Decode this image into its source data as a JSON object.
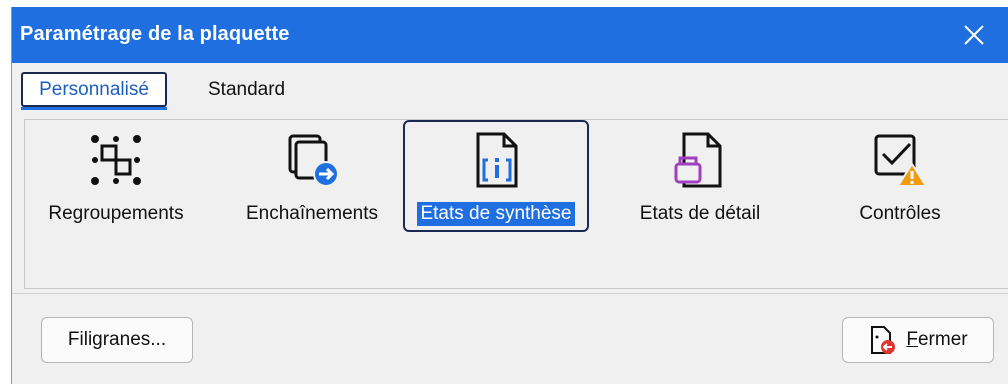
{
  "window": {
    "title": "Paramétrage de la plaquette",
    "close_icon": "close-icon"
  },
  "tabs": [
    {
      "label": "Personnalisé",
      "active": true
    },
    {
      "label": "Standard",
      "active": false
    }
  ],
  "toolbar": {
    "items": [
      {
        "label": "Regroupements",
        "icon": "grouping-icon",
        "selected": false
      },
      {
        "label": "Enchaînements",
        "icon": "chaining-icon",
        "selected": false
      },
      {
        "label": "Etats de synthèse",
        "icon": "summary-report-icon",
        "selected": true
      },
      {
        "label": "Etats de détail",
        "icon": "detail-report-icon",
        "selected": false
      },
      {
        "label": "Contrôles",
        "icon": "controls-warning-icon",
        "selected": false
      }
    ]
  },
  "footer": {
    "watermarks_label": "Filigranes...",
    "close_label_first": "F",
    "close_label_rest": "ermer"
  },
  "colors": {
    "accent": "#1f6fe0",
    "dialog_bg": "#f0f0f0"
  }
}
